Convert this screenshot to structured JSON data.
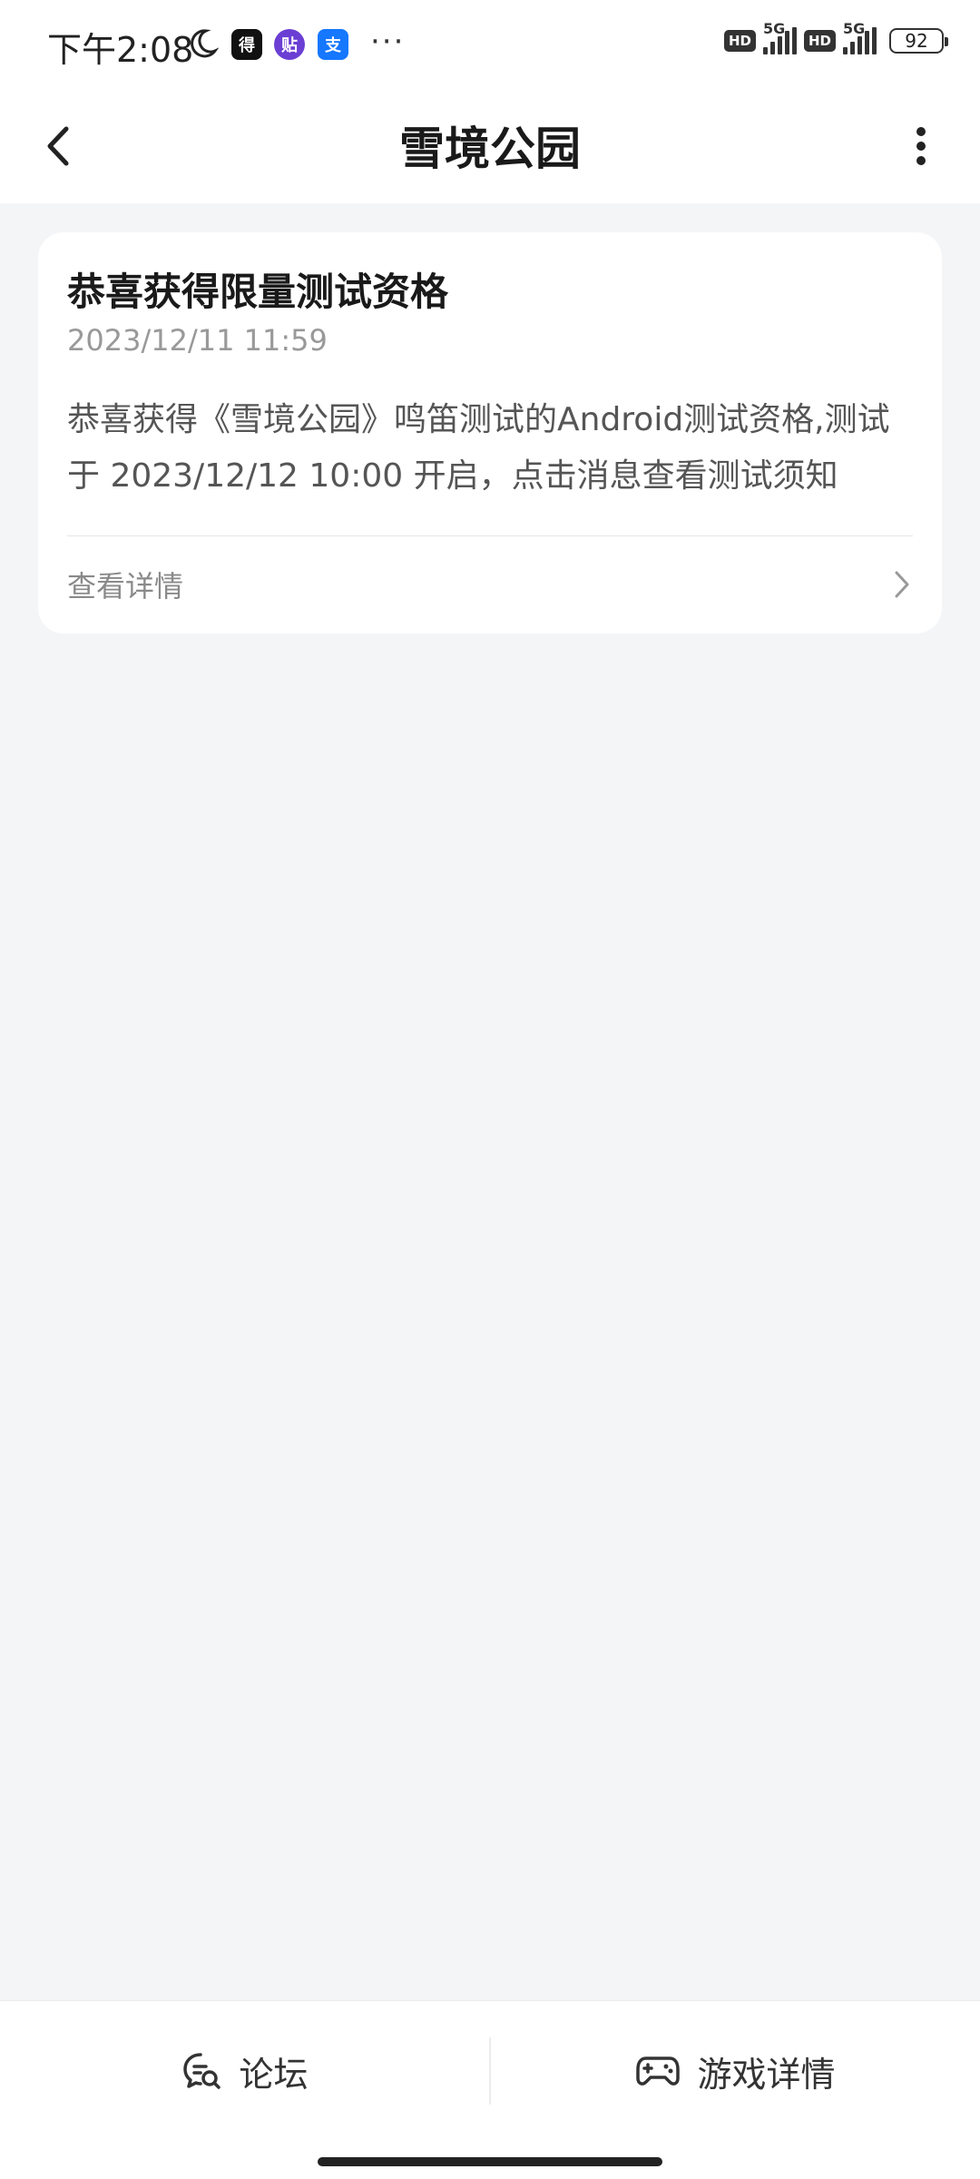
{
  "status_bar": {
    "time": "下午2:08",
    "icons": [
      "moon-icon",
      "app-icon-dechat",
      "app-icon-tieba",
      "app-icon-alipay"
    ],
    "app_icon_labels": [
      "得",
      "贴",
      "支"
    ],
    "more": "···",
    "hd1": "HD",
    "net1": "5G",
    "hd2": "HD",
    "net2": "5G",
    "battery": "92"
  },
  "header": {
    "title": "雪境公园",
    "back_icon": "back-arrow-icon",
    "more_icon": "more-vertical-icon"
  },
  "card": {
    "title": "恭喜获得限量测试资格",
    "time": "2023/12/11 11:59",
    "body": "恭喜获得《雪境公园》鸣笛测试的Android测试资格,测试于 2023/12/12 10:00 开启，点击消息查看测试须知",
    "link_label": "查看详情",
    "link_icon": "chevron-right-icon"
  },
  "bottom_bar": {
    "left_label": "论坛",
    "left_icon": "forum-chat-icon",
    "right_label": "游戏详情",
    "right_icon": "gamepad-icon"
  },
  "colors": {
    "background": "#f4f5f7",
    "card": "#ffffff",
    "title_text": "#1a1a1a",
    "secondary_text": "#999999"
  }
}
